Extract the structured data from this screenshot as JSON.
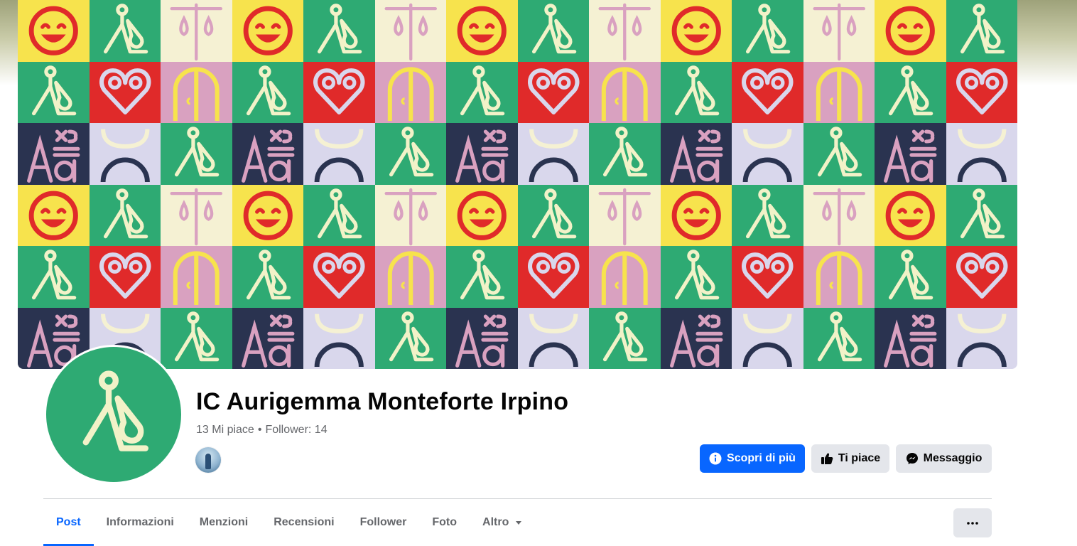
{
  "page": {
    "name": "IC Aurigemma Monteforte Irpino",
    "likes": "13 Mi piace",
    "separator": "•",
    "followers": "Follower: 14"
  },
  "actions": {
    "learn_more": "Scopri di più",
    "like": "Ti piace",
    "message": "Messaggio"
  },
  "tabs": [
    {
      "label": "Post",
      "active": true
    },
    {
      "label": "Informazioni"
    },
    {
      "label": "Menzioni"
    },
    {
      "label": "Recensioni"
    },
    {
      "label": "Follower"
    },
    {
      "label": "Foto"
    },
    {
      "label": "Altro",
      "has_dropdown": true
    }
  ],
  "icons": {
    "info": "info-icon",
    "like": "thumbs-up-icon",
    "message": "messenger-icon",
    "dropdown": "caret-down-icon",
    "more": "ellipsis-icon"
  },
  "colors": {
    "accent": "#0866ff",
    "secondary_button": "#e4e6eb",
    "muted_text": "#65676b",
    "logo_green": "#2eaa73",
    "logo_cream": "#f2f2c8",
    "tile_yellow": "#f7e34d",
    "tile_red": "#e02a2a",
    "tile_pink": "#d9a1c0",
    "tile_lavender": "#d9d7ec",
    "tile_navy": "#2a3350",
    "tile_cream": "#f5f1d3"
  }
}
